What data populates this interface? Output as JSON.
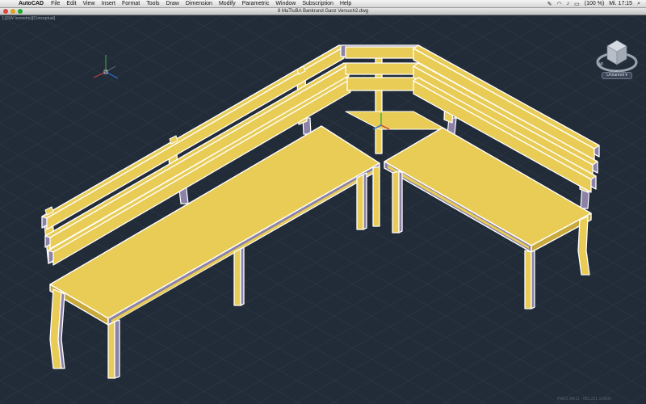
{
  "menubar": {
    "apple_glyph": "",
    "app_name": "AutoCAD",
    "items": [
      "File",
      "Edit",
      "View",
      "Insert",
      "Format",
      "Tools",
      "Draw",
      "Dimension",
      "Modify",
      "Parametric",
      "Window",
      "Subscription",
      "Help"
    ],
    "battery": "(100 %)",
    "day_time": "Mi. 17:15"
  },
  "window": {
    "title": "8 MaTluBA Bankrund Ganz Versuch2.dwg"
  },
  "viewport": {
    "label": "[-][SW Isometric][Conceptual]",
    "background": "#222c38",
    "grid_color": "#2e3a48",
    "wcs_label": "Unnamed ▾",
    "status_text": "PMX1 MK11 - 681.221 1.0000"
  },
  "colors": {
    "bench_top": "#e8cc56",
    "bench_front": "#c9a93b",
    "bench_side": "#b99a34",
    "edge_outline": "#ffffff",
    "shadow": "#8c82a8",
    "axis_x": "#c8403c",
    "axis_y": "#3fb04c",
    "axis_z": "#2c6fd6"
  },
  "icons": {
    "close": "close-icon",
    "minimize": "minimize-icon",
    "zoom": "zoom-icon",
    "viewcube": "viewcube-icon",
    "ucs": "ucs-icon"
  }
}
